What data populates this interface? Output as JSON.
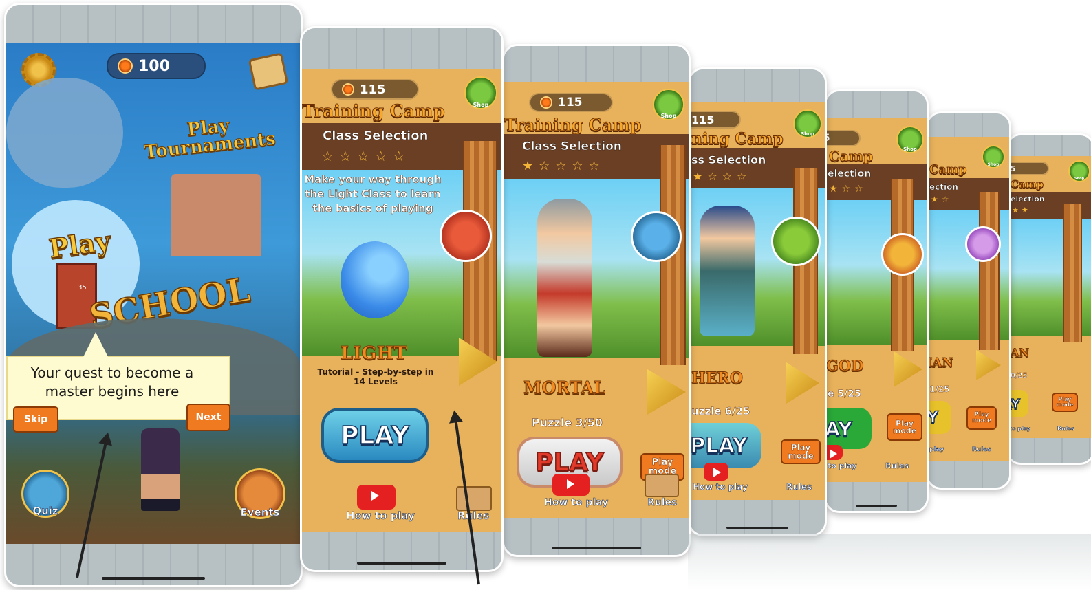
{
  "screen1": {
    "coins": "100",
    "tournaments": "Play\nTournaments",
    "play_label": "Play",
    "school_text": "SCHOOL",
    "stool_count": "35",
    "tooltip_text": "Your quest to become a master begins here",
    "skip_label": "Skip",
    "next_label": "Next",
    "quiz_label": "Quiz",
    "events_label": "Events"
  },
  "screen2": {
    "coins": "115",
    "title": "Training Camp",
    "shop": "Shop",
    "class_selection": "Class Selection",
    "stars": "☆☆☆☆☆",
    "intro": "Make your way through the Light Class to learn the basics of playing",
    "class_name": "LIGHT",
    "class_desc": "Tutorial - Step-by-step in 14 Levels",
    "play_label": "PLAY",
    "how_to_play": "How to play",
    "rules": "Rules"
  },
  "screen3": {
    "coins": "115",
    "title": "Training Camp",
    "shop": "Shop",
    "class_selection": "Class Selection",
    "stars": "★☆☆☆☆",
    "class_name": "MORTAL",
    "puzzle": "Puzzle 3/50",
    "play_label": "PLAY",
    "play_mode": "Play mode",
    "how_to_play": "How to play",
    "rules": "Rules"
  },
  "screen4": {
    "coins": "115",
    "title": "ning Camp",
    "shop": "Shop",
    "class_selection": "ss Selection",
    "stars": "★☆☆☆",
    "class_name": "HERO",
    "puzzle": "uzzle 6/25",
    "play_label": "PLAY",
    "play_mode": "Play mode",
    "how_to_play": "How to play",
    "rules": "Rules"
  },
  "screen5": {
    "coins": "15",
    "title": "Camp",
    "shop": "Shop",
    "class_selection": "election",
    "stars": "★☆☆",
    "class_name": "GOD",
    "puzzle": "e 5/25",
    "play_label": "AY",
    "play_mode": "Play mode",
    "how_to_play": "to play",
    "rules": "Rules"
  },
  "screen6": {
    "title": "Camp",
    "shop": "Shop",
    "class_selection": "ection",
    "stars": "★☆",
    "class_name": "IAN",
    "puzzle": "1/25",
    "play_label": "Y",
    "play_mode": "Play mode",
    "how_to_play": "play",
    "rules": "Rules"
  },
  "screen7": {
    "coins": "15",
    "title": "Camp",
    "shop": "Shop",
    "class_selection": "election",
    "stars": "★★",
    "class_name": "AN",
    "puzzle": "0/25",
    "play_label": "AY",
    "play_mode": "Play mode",
    "how_to_play": "to play",
    "rules": "Rules"
  }
}
